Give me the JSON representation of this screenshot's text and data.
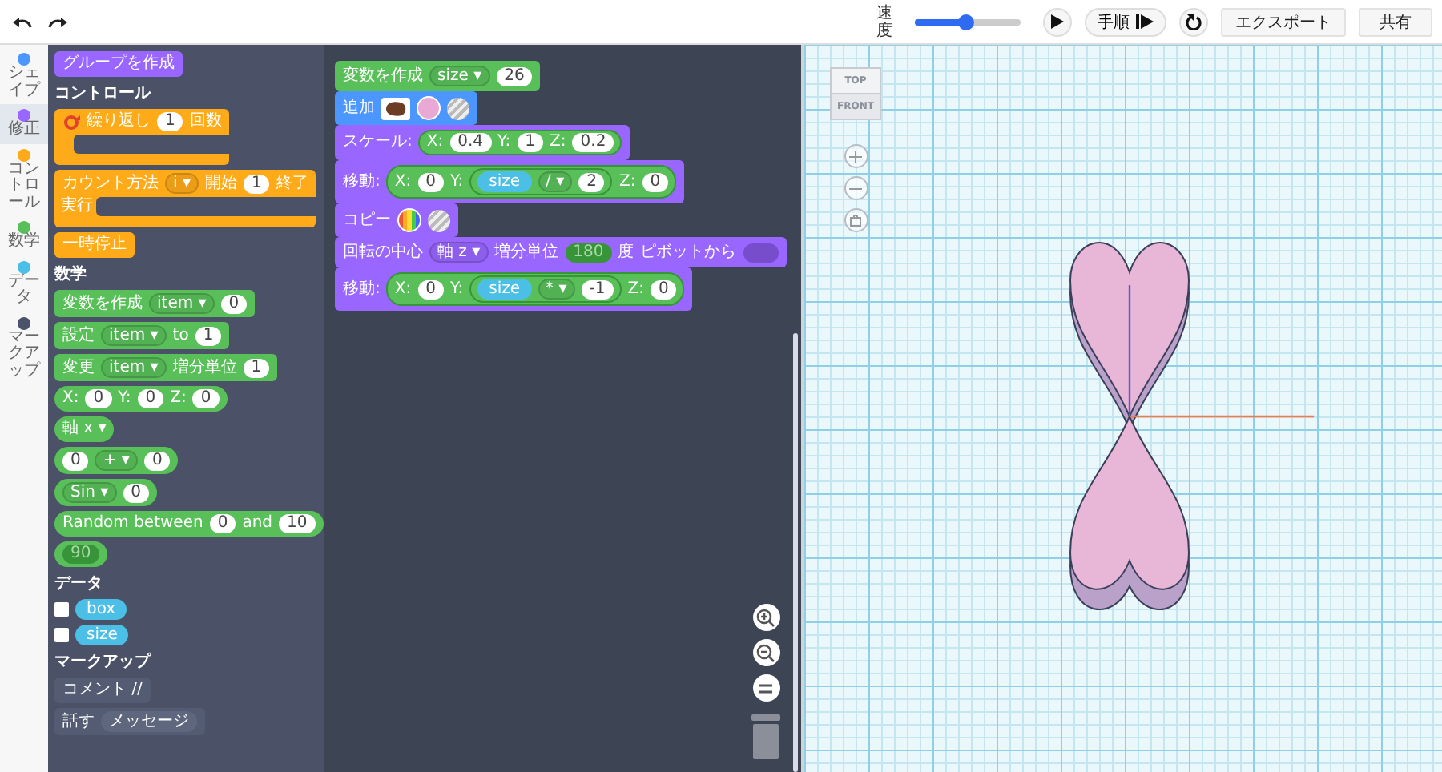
{
  "toolbar": {
    "speed_label": "速度",
    "speed": {
      "level": 0.48
    },
    "step_label": "手順",
    "export": "エクスポート",
    "share": "共有"
  },
  "categories": [
    {
      "label": "シェイプ",
      "color": "#4c97ff",
      "selected": false
    },
    {
      "label": "修正",
      "color": "#9966ff",
      "selected": true
    },
    {
      "label": "コントロール",
      "color": "#ffab19",
      "selected": false
    },
    {
      "label": "数学",
      "color": "#59c059",
      "selected": false
    },
    {
      "label": "データ",
      "color": "#4cbfe6",
      "selected": false
    },
    {
      "label": "マークアップ",
      "color": "#4a5369",
      "selected": false
    }
  ],
  "palette": [
    {
      "kind": "stack",
      "color": "#9966ff",
      "parts": [
        {
          "kind": "text",
          "text": "グループを作成"
        }
      ]
    },
    {
      "kind": "heading",
      "text": "コントロール"
    },
    {
      "kind": "c",
      "color": "#ffab19",
      "parts": [
        {
          "kind": "repeat-icon"
        },
        {
          "kind": "text",
          "text": "繰り返し"
        },
        {
          "kind": "num",
          "text": "1"
        },
        {
          "kind": "text",
          "text": "回数"
        }
      ]
    },
    {
      "kind": "c",
      "color": "#ffab19",
      "arm": "実行",
      "parts": [
        {
          "kind": "text",
          "text": "カウント方法"
        },
        {
          "kind": "dropdown",
          "text": "i ▾"
        },
        {
          "kind": "text",
          "text": "開始"
        },
        {
          "kind": "num",
          "text": "1"
        },
        {
          "kind": "text",
          "text": "終了"
        }
      ]
    },
    {
      "kind": "stack",
      "color": "#ffab19",
      "parts": [
        {
          "kind": "text",
          "text": "一時停止"
        }
      ]
    },
    {
      "kind": "heading",
      "text": "数学"
    },
    {
      "kind": "stack",
      "color": "#59c059",
      "parts": [
        {
          "kind": "text",
          "text": "変数を作成"
        },
        {
          "kind": "dropdown",
          "text": "item ▾"
        },
        {
          "kind": "num",
          "text": "0"
        }
      ]
    },
    {
      "kind": "stack",
      "color": "#59c059",
      "parts": [
        {
          "kind": "text",
          "text": "設定"
        },
        {
          "kind": "dropdown",
          "text": "item ▾"
        },
        {
          "kind": "text",
          "text": "to"
        },
        {
          "kind": "num",
          "text": "1"
        }
      ]
    },
    {
      "kind": "stack",
      "color": "#59c059",
      "parts": [
        {
          "kind": "text",
          "text": "変更"
        },
        {
          "kind": "dropdown",
          "text": "item ▾"
        },
        {
          "kind": "text",
          "text": "増分単位"
        },
        {
          "kind": "num",
          "text": "1"
        }
      ]
    },
    {
      "kind": "reporter",
      "color": "#59c059",
      "parts": [
        {
          "kind": "text",
          "text": "X:"
        },
        {
          "kind": "num",
          "text": "0"
        },
        {
          "kind": "text",
          "text": "Y:"
        },
        {
          "kind": "num",
          "text": "0"
        },
        {
          "kind": "text",
          "text": "Z:"
        },
        {
          "kind": "num",
          "text": "0"
        }
      ]
    },
    {
      "kind": "reporter",
      "color": "#59c059",
      "parts": [
        {
          "kind": "text",
          "text": "軸 x ▾"
        }
      ]
    },
    {
      "kind": "reporter",
      "color": "#59c059",
      "parts": [
        {
          "kind": "num",
          "text": "0"
        },
        {
          "kind": "dropdown",
          "text": "+ ▾"
        },
        {
          "kind": "num",
          "text": "0"
        }
      ]
    },
    {
      "kind": "reporter",
      "color": "#59c059",
      "parts": [
        {
          "kind": "dropdown",
          "text": "Sin ▾"
        },
        {
          "kind": "num",
          "text": "0"
        }
      ]
    },
    {
      "kind": "reporter",
      "color": "#59c059",
      "parts": [
        {
          "kind": "text",
          "text": "Random between"
        },
        {
          "kind": "num",
          "text": "0"
        },
        {
          "kind": "text",
          "text": "and"
        },
        {
          "kind": "num",
          "text": "10"
        }
      ]
    },
    {
      "kind": "reporter",
      "color": "#59c059",
      "parts": [
        {
          "kind": "shadow",
          "text": "90"
        }
      ]
    },
    {
      "kind": "heading",
      "text": "データ"
    },
    {
      "kind": "variable",
      "text": "box",
      "checked": false
    },
    {
      "kind": "variable",
      "text": "size",
      "checked": false
    },
    {
      "kind": "heading",
      "text": "マークアップ"
    },
    {
      "kind": "stack",
      "color": "#535c72",
      "parts": [
        {
          "kind": "text",
          "text": "コメント //"
        }
      ]
    },
    {
      "kind": "stack",
      "color": "#535c72",
      "parts": [
        {
          "kind": "text",
          "text": "話す"
        },
        {
          "kind": "field",
          "text": "メッセージ"
        }
      ]
    }
  ],
  "workspace": [
    {
      "color": "#59c059",
      "parts": [
        {
          "kind": "text",
          "text": "変数を作成"
        },
        {
          "kind": "dropdown",
          "text": "size ▾"
        },
        {
          "kind": "num",
          "text": "26"
        }
      ]
    },
    {
      "color": "#4c97ff",
      "parts": [
        {
          "kind": "text",
          "text": "追加"
        },
        {
          "kind": "shape-thumb"
        },
        {
          "kind": "swatch",
          "color": "#eaa8d4"
        },
        {
          "kind": "texture"
        }
      ]
    },
    {
      "color": "#9966ff",
      "parts": [
        {
          "kind": "text",
          "text": "スケール:"
        },
        {
          "kind": "reporter",
          "parts": [
            {
              "kind": "text",
              "text": "X:"
            },
            {
              "kind": "num",
              "text": "0.4"
            },
            {
              "kind": "text",
              "text": "Y:"
            },
            {
              "kind": "num",
              "text": "1"
            },
            {
              "kind": "text",
              "text": "Z:"
            },
            {
              "kind": "num",
              "text": "0.2"
            }
          ]
        }
      ]
    },
    {
      "color": "#9966ff",
      "parts": [
        {
          "kind": "text",
          "text": "移動:"
        },
        {
          "kind": "reporter",
          "parts": [
            {
              "kind": "text",
              "text": "X:"
            },
            {
              "kind": "num",
              "text": "0"
            },
            {
              "kind": "text",
              "text": "Y:"
            },
            {
              "kind": "reporter",
              "parts": [
                {
                  "kind": "var",
                  "text": "size"
                },
                {
                  "kind": "dropdown",
                  "text": "/ ▾"
                },
                {
                  "kind": "num",
                  "text": "2"
                }
              ]
            },
            {
              "kind": "text",
              "text": "Z:"
            },
            {
              "kind": "num",
              "text": "0"
            }
          ]
        }
      ]
    },
    {
      "color": "#9966ff",
      "parts": [
        {
          "kind": "text",
          "text": "コピー"
        },
        {
          "kind": "rainbow"
        },
        {
          "kind": "texture"
        }
      ]
    },
    {
      "color": "#9966ff",
      "parts": [
        {
          "kind": "text",
          "text": "回転の中心"
        },
        {
          "kind": "dropdown",
          "text": "軸 z ▾"
        },
        {
          "kind": "text",
          "text": "増分単位"
        },
        {
          "kind": "shadow",
          "text": "180"
        },
        {
          "kind": "text",
          "text": "度"
        },
        {
          "kind": "text",
          "text": "ピボットから"
        },
        {
          "kind": "slot"
        }
      ]
    },
    {
      "color": "#9966ff",
      "parts": [
        {
          "kind": "text",
          "text": "移動:"
        },
        {
          "kind": "reporter",
          "parts": [
            {
              "kind": "text",
              "text": "X:"
            },
            {
              "kind": "num",
              "text": "0"
            },
            {
              "kind": "text",
              "text": "Y:"
            },
            {
              "kind": "reporter",
              "parts": [
                {
                  "kind": "var",
                  "text": "size"
                },
                {
                  "kind": "dropdown",
                  "text": "* ▾"
                },
                {
                  "kind": "num",
                  "text": "-1"
                }
              ]
            },
            {
              "kind": "text",
              "text": "Z:"
            },
            {
              "kind": "num",
              "text": "0"
            }
          ]
        }
      ]
    }
  ],
  "view_cube": {
    "top": "TOP",
    "front": "FRONT"
  }
}
